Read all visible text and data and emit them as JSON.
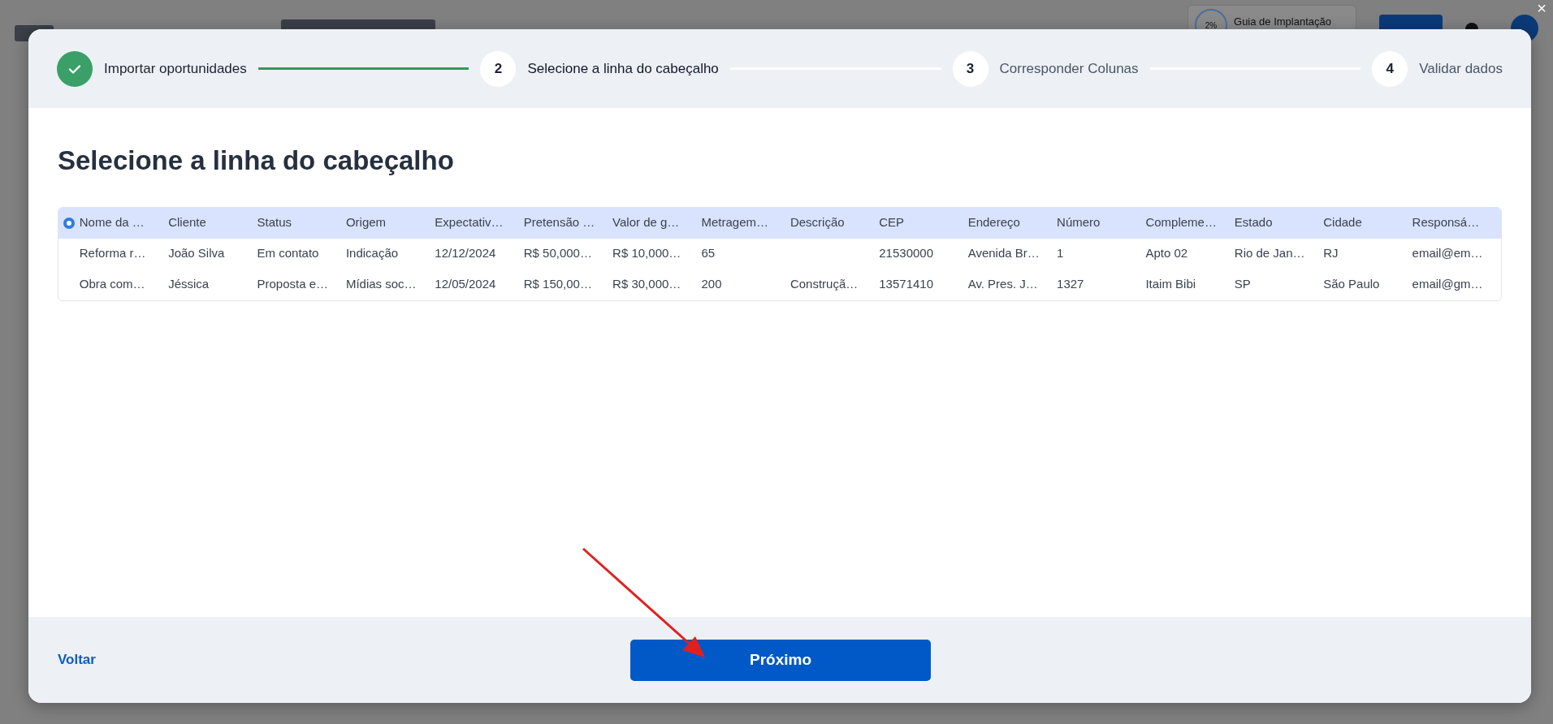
{
  "background_app": {
    "guide_progress": "2%",
    "guide_label": "Guia de Implantação"
  },
  "close_button": "×",
  "stepper": [
    {
      "label": "Importar oportunidades",
      "done": true,
      "selected": false
    },
    {
      "number": "2",
      "label": "Selecione a linha do cabeçalho",
      "done": false,
      "selected": true
    },
    {
      "number": "3",
      "label": "Corresponder Colunas",
      "done": false,
      "selected": false
    },
    {
      "number": "4",
      "label": "Validar dados",
      "done": false,
      "selected": false
    }
  ],
  "heading": "Selecione a linha do cabeçalho",
  "table": {
    "rows": [
      {
        "selected": true,
        "cells": [
          "Nome da …",
          "Cliente",
          "Status",
          "Origem",
          "Expectativ…",
          "Pretensão …",
          "Valor de g…",
          "Metragem…",
          "Descrição",
          "CEP",
          "Endereço",
          "Número",
          "Compleme…",
          "Estado",
          "Cidade",
          "Responsá…"
        ]
      },
      {
        "selected": false,
        "cells": [
          "Reforma r…",
          "João Silva",
          "Em contato",
          "Indicação",
          "12/12/2024",
          "R$ 50,000…",
          "R$ 10,000…",
          "65",
          "",
          "21530000",
          "Avenida Br…",
          "1",
          "Apto 02",
          "Rio de Jan…",
          "RJ",
          "email@em…"
        ]
      },
      {
        "selected": false,
        "cells": [
          "Obra com…",
          "Jéssica",
          "Proposta e…",
          "Mídias soc…",
          "12/05/2024",
          "R$ 150,00…",
          "R$ 30,000…",
          "200",
          "Construçã…",
          "13571410",
          "Av. Pres. J…",
          "1327",
          "Itaim Bibi",
          "SP",
          "São Paulo",
          "email@gm…"
        ]
      }
    ]
  },
  "footer": {
    "back_link": "Voltar",
    "next_button": "Próximo"
  }
}
